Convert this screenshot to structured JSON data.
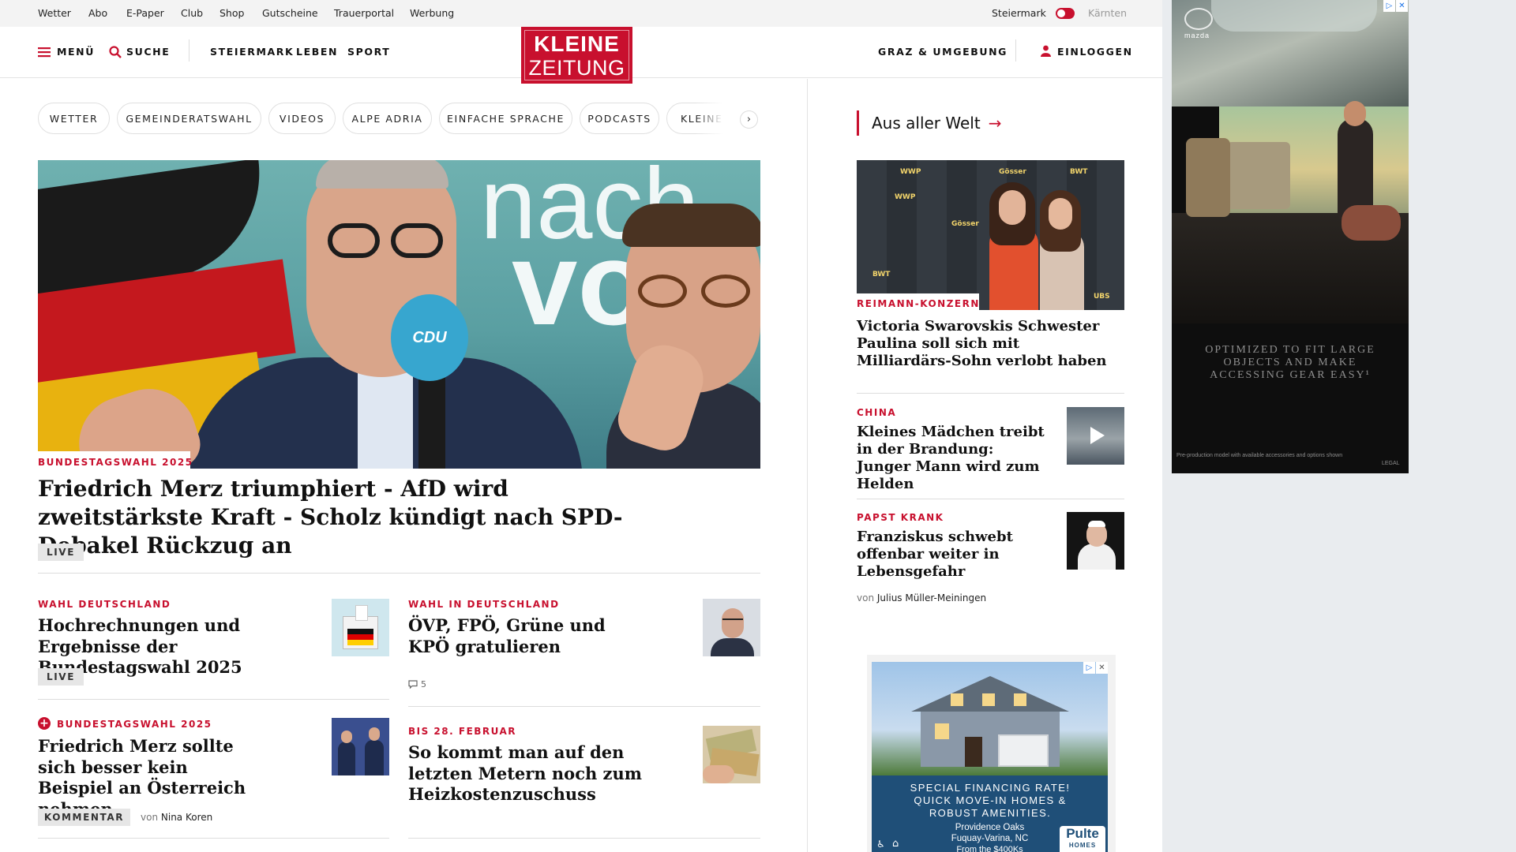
{
  "util_nav": [
    "Wetter",
    "Abo",
    "E-Paper",
    "Club",
    "Shop",
    "Gutscheine",
    "Trauerportal",
    "Werbung"
  ],
  "region_toggle": {
    "left": "Steiermark",
    "right": "Kärnten"
  },
  "header": {
    "menu": "MENÜ",
    "search": "SUCHE",
    "sections": [
      "STEIERMARK",
      "LEBEN",
      "SPORT"
    ],
    "logo_top": "KLEINE",
    "logo_bottom": "ZEITUNG",
    "region": "GRAZ & UMGEBUNG",
    "login": "EINLOGGEN"
  },
  "topics": [
    "WETTER",
    "GEMEINDERATSWAHL",
    "VIDEOS",
    "ALPE ADRIA",
    "EINFACHE SPRACHE",
    "PODCASTS",
    "KLEINE"
  ],
  "lead": {
    "kicker": "BUNDESTAGSWAHL 2025",
    "title": "Friedrich Merz triumphiert - AfD wird zweitstärkste Kraft - Scholz kündigt nach SPD-Debakel Rückzug an",
    "badge": "LIVE",
    "image_text_1": "nach",
    "image_text_2": "vo",
    "mic_label": "CDU"
  },
  "articles": [
    {
      "kicker": "WAHL DEUTSCHLAND",
      "title": "Hochrechnungen und Ergebnisse der Bundestagswahl 2025",
      "badge": "LIVE"
    },
    {
      "kicker": "WAHL IN DEUTSCHLAND",
      "title": "ÖVP, FPÖ, Grüne und KPÖ gratulieren",
      "comments": "5"
    },
    {
      "kicker": "BUNDESTAGSWAHL 2025",
      "title": "Friedrich Merz sollte sich besser kein Beispiel an Österreich nehmen",
      "badge": "KOMMENTAR",
      "author_prefix": "von",
      "author": "Nina Koren"
    },
    {
      "kicker": "BIS 28. FEBRUAR",
      "title": "So kommt man auf den letzten Metern noch zum Heizkostenzuschuss"
    }
  ],
  "sidebar": {
    "title": "Aus aller Welt",
    "feature": {
      "kicker": "REIMANN-KONZERN",
      "title": "Victoria Swarovskis Schwester Paulina soll sich mit Milliardärs-Sohn verlobt haben",
      "sponsor_logos": [
        "WWP",
        "Gösser",
        "BWT",
        "UBS"
      ]
    },
    "items": [
      {
        "kicker": "CHINA",
        "title": "Kleines Mädchen treibt in der Brandung: Junger Mann wird zum Helden"
      },
      {
        "kicker": "PAPST KRANK",
        "title": "Franziskus schwebt offenbar weiter in Lebensgefahr",
        "author_prefix": "von",
        "author": "Julius Müller-Meiningen"
      }
    ]
  },
  "ads": {
    "top": {
      "tagline": "OPTIMIZED TO FIT LARGE OBJECTS AND MAKE ACCESSING GEAR EASY¹",
      "footnote": "Pre-production model with available accessories and options shown",
      "legal": "LEGAL",
      "brand": "mazda"
    },
    "mid": {
      "headline": "SPECIAL FINANCING RATE! QUICK MOVE-IN HOMES & ROBUST AMENITIES.",
      "community": "Providence Oaks",
      "location": "Fuquay-Varina, NC",
      "price": "From the $400Ks",
      "brand": "Pulte",
      "brand_sub": "HOMES"
    }
  },
  "colors": {
    "accent": "#c8102e",
    "text": "#111111",
    "badge_bg": "#e6e6e6"
  }
}
